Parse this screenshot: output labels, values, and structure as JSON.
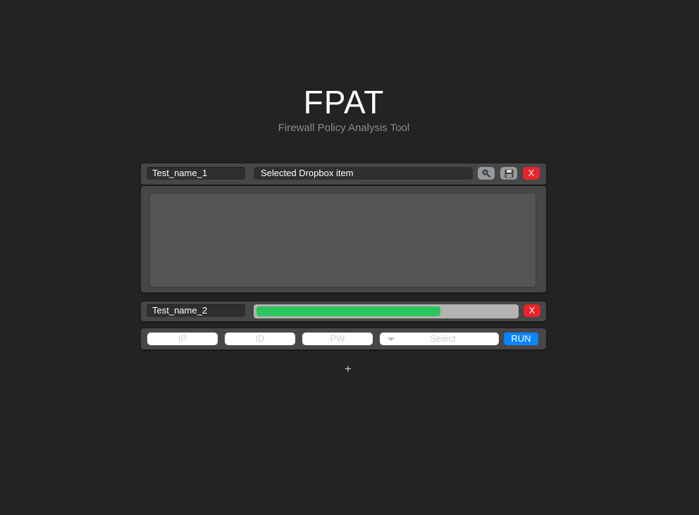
{
  "header": {
    "title": "FPAT",
    "subtitle": "Firewall Policy Analysis Tool"
  },
  "tasks": [
    {
      "name": "Test_name_1",
      "dropbox_selected": "Selected Dropbox item",
      "search_icon": "search-icon",
      "save_icon": "save-icon",
      "close_label": "X"
    },
    {
      "name": "Test_name_2",
      "progress_percent": 71,
      "close_label": "X"
    }
  ],
  "connection_form": {
    "ip_placeholder": "IP",
    "id_placeholder": "ID",
    "pw_placeholder": "PW",
    "select_placeholder": "Select",
    "run_label": "RUN"
  },
  "add_button_label": "+",
  "colors": {
    "background": "#232323",
    "panel": "#474747",
    "input_dark": "#2f2f2f",
    "close_red": "#e8232b",
    "progress_green": "#2cc55d",
    "run_blue": "#0a84ff"
  }
}
